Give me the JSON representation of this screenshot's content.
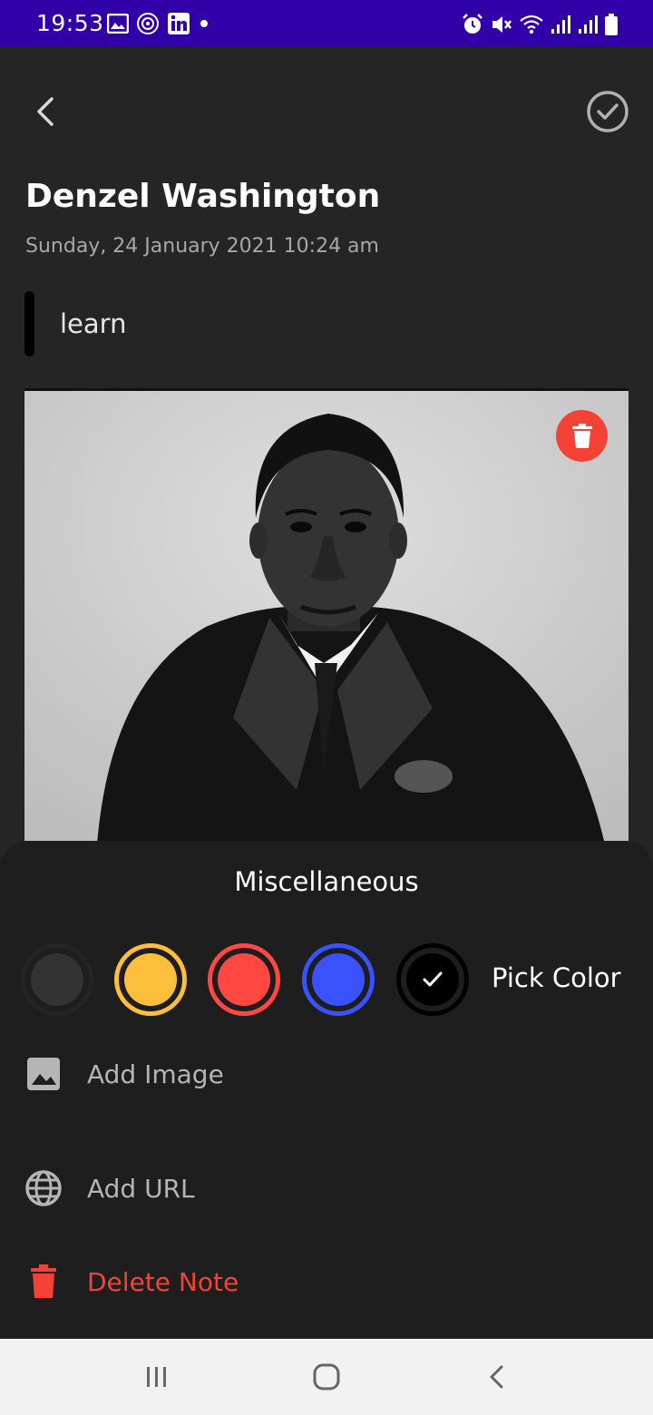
{
  "status_bar": {
    "time": "19:53",
    "left_icons": [
      "image-icon",
      "manchester-united-icon",
      "linkedin-icon",
      "dot-icon"
    ],
    "right_icons": [
      "alarm-icon",
      "mute-icon",
      "wifi-icon",
      "signal-icon",
      "signal-icon",
      "battery-icon"
    ]
  },
  "header": {
    "back_icon": "chevron-left-icon",
    "save_icon": "check-circle-icon"
  },
  "note": {
    "title": "Denzel Washington",
    "datetime": "Sunday, 24 January 2021 10:24 am",
    "subtitle": "learn",
    "subtitle_indicator_color": "#000000",
    "image_remove_icon": "trash-icon"
  },
  "miscellaneous": {
    "title": "Miscellaneous",
    "colors": [
      {
        "name": "default",
        "color": "#333333",
        "ring": "#222222",
        "selected": false
      },
      {
        "name": "yellow",
        "color": "#fdbe3b",
        "ring": "#fdbe3b",
        "selected": false
      },
      {
        "name": "red",
        "color": "#ff4842",
        "ring": "#ff4842",
        "selected": false
      },
      {
        "name": "blue",
        "color": "#3a52fc",
        "ring": "#3a52fc",
        "selected": false
      },
      {
        "name": "black",
        "color": "#000000",
        "ring": "#000000",
        "selected": true
      }
    ],
    "pick_color_label": "Pick Color",
    "add_image_label": "Add Image",
    "add_url_label": "Add URL",
    "delete_note_label": "Delete Note"
  },
  "nav_bar": {
    "recents_icon": "recents-icon",
    "home_icon": "home-icon",
    "back_icon": "back-icon"
  },
  "theme": {
    "background": "#252525",
    "sheet": "#1e1e1e",
    "status_bar": "#3100a8",
    "danger": "#f44336",
    "muted_text": "#a8a8a8"
  }
}
